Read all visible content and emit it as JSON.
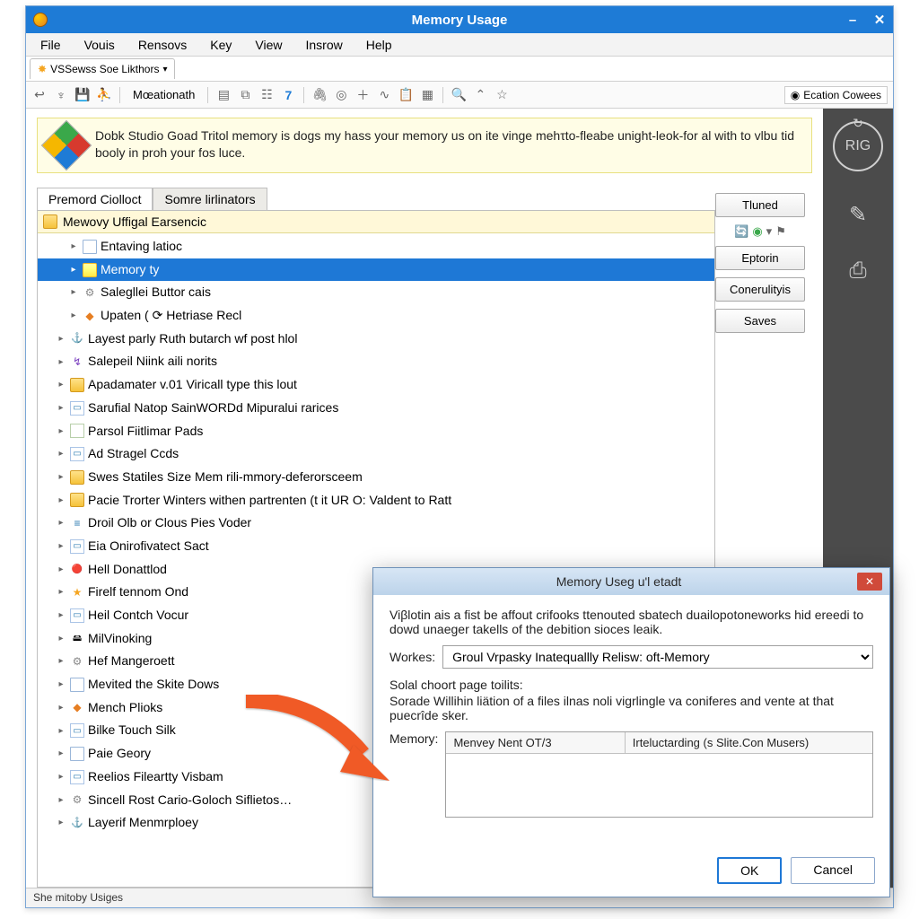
{
  "window": {
    "title": "Memory Usage",
    "minimize": "–",
    "close": "✕"
  },
  "menu": [
    "File",
    "Vouis",
    "Rensovs",
    "Key",
    "View",
    "Insrow",
    "Help"
  ],
  "doc_tab": {
    "label": "VSSewss Soe Likthors"
  },
  "toolbar": {
    "text_item": "Mœationath",
    "seven": "7",
    "right_chip": "Ecation Cowees"
  },
  "banner": {
    "text": "Dobk Studio Goad Tritol memory is dogs my hass your memory us on ite vinge mehτto-fleabe unight-leok-for al with to vlbu tid booly in proh your fos luce."
  },
  "sub_tabs": {
    "a": "Premord Ciolloct",
    "b": "Somre lirlinators"
  },
  "tree": {
    "head": "Mewovy Uffigal Earsencic",
    "items": [
      "Entaving latioc",
      "Memory ty",
      "Salegllei Buttor cais",
      "Upaten ( ⟳  Hetriase Recl",
      "Layest parly Ruth butarch wf post hlol",
      "Salepeil Niink aili norits",
      "Apadamater v.01 Viricall type this lout",
      "Sarufial Natop SainWORDd Mipuralui rarices",
      "Parsol Fiitlimar Pads",
      "Ad Stragel Ccds",
      "Swes Statiles Size Mem rili-mmory-deferorsceem",
      "Pacie Trorter Winters withen partrenten (t it UR O: Valdent to Ratt",
      "Droil Olb or Clous Pies Voder",
      "Eia Onirofivatect Sact",
      "Hell Donattlod",
      "Firelf tennom Ond",
      "Heil Contch Vocur",
      "MilVinoking",
      "Hef Mangeroett",
      "Mevited the Skite Dows",
      "Mench Plioks",
      "Bilke Touch Silk",
      "Paie Geory",
      "Reelios Fileartty Visbam",
      "Sincell Rost Cario-Goloch Siflietos…",
      "Layerif Menmrploey"
    ],
    "selected_index": 1
  },
  "aside": {
    "btn1": "Tluned",
    "btn2": "Eptorin",
    "btn3": "Conerulityis",
    "btn4": "Saves"
  },
  "ribbon": {
    "rig": "RIG"
  },
  "status": "She mitoby Usiges",
  "dialog": {
    "title": "Memory Useg u'l etadt",
    "intro": "Viβlotin ais a fist be affout crifooks ttenouted sbatech duailopotoneworks hid ereedi to dowd unaeger takells of the debition sioces leaik.",
    "works_label": "Workes:",
    "works_value": "Groul Vrpasky Inatequallly Relisw: oft-Memory",
    "sub_label": "Solal choort page toilits:",
    "sub_text": "Sorade Willihin liätion of a files ilnas noli vigrlingle va coniferes and vente at that puecrîde sker.",
    "mem_label": "Memory:",
    "col1": "Menvey Nent OT/3",
    "col2": "Irteluctarding (s Slite.Con Musers)",
    "ok": "OK",
    "cancel": "Cancel"
  }
}
